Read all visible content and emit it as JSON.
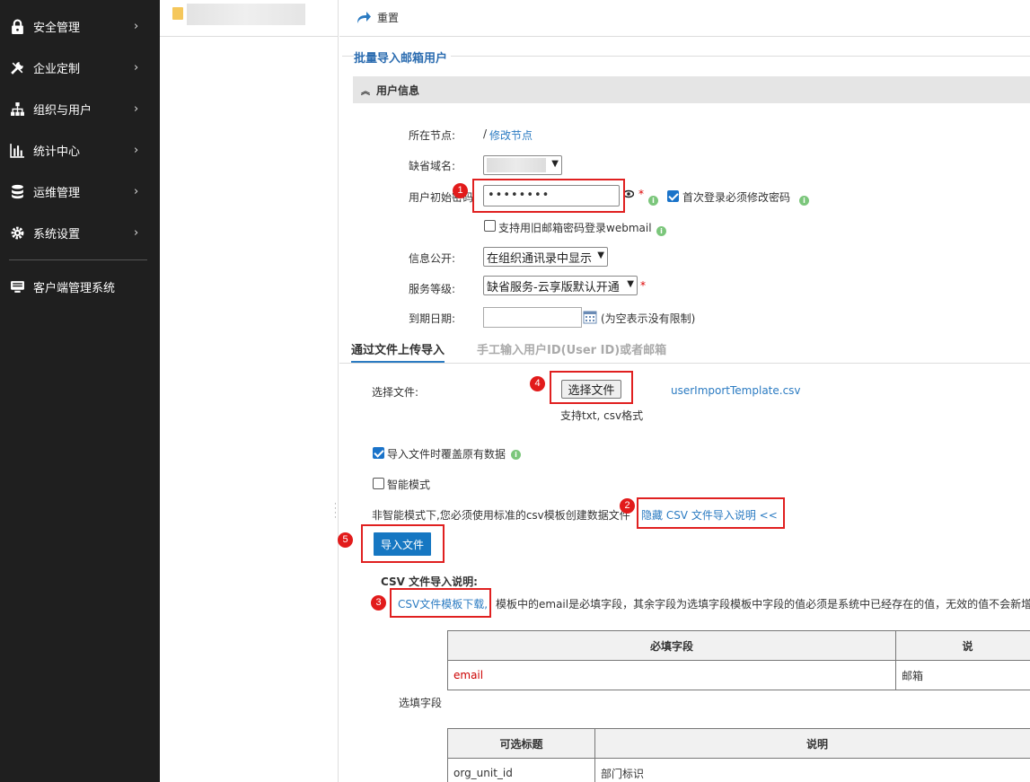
{
  "sidebar": {
    "items": [
      {
        "label": "安全管理",
        "icon": "lock-icon"
      },
      {
        "label": "企业定制",
        "icon": "tools-icon"
      },
      {
        "label": "组织与用户",
        "icon": "org-chart-icon"
      },
      {
        "label": "统计中心",
        "icon": "bar-chart-icon"
      },
      {
        "label": "运维管理",
        "icon": "database-icon"
      },
      {
        "label": "系统设置",
        "icon": "gear-icon"
      }
    ],
    "client_item": {
      "label": "客户端管理系统",
      "icon": "monitor-icon"
    }
  },
  "toolbar": {
    "reset_label": "重置"
  },
  "section": {
    "title": "批量导入邮箱用户"
  },
  "panel": {
    "title": "用户信息"
  },
  "form": {
    "node_label": "所在节点:",
    "node_path": "/",
    "node_link": "修改节点",
    "domain_label": "缺省域名:",
    "password_label": "用户初始密码",
    "password_value": "••••••••",
    "force_change_label": "首次登录必须修改密码",
    "legacy_webmail_label": "支持用旧邮箱密码登录webmail",
    "visibility_label": "信息公开:",
    "visibility_value": "在组织通讯录中显示",
    "service_label": "服务等级:",
    "service_value": "缺省服务-云享版默认开通",
    "expire_label": "到期日期:",
    "expire_hint": "(为空表示没有限制)"
  },
  "tabs": [
    {
      "label": "通过文件上传导入",
      "active": true
    },
    {
      "label": "手工输入用户ID(User ID)或者邮箱",
      "active": false
    }
  ],
  "upload": {
    "file_label": "选择文件:",
    "choose_button": "选择文件",
    "template_link": "userImportTemplate.csv",
    "format_hint": "支持txt, csv格式",
    "overwrite_label": "导入文件时覆盖原有数据",
    "smart_label": "智能模式",
    "notice_text": "非智能模式下,您必须使用标准的csv模板创建数据文件",
    "toggle_link": "隐藏 CSV 文件导入说明 <<",
    "import_button": "导入文件"
  },
  "csv_help": {
    "title": "CSV 文件导入说明:",
    "download_link": "CSV文件模板下载,",
    "description": "模板中的email是必填字段，其余字段为选填字段模板中字段的值必须是系统中已经存在的值，无效的值不会新增到",
    "required_table": {
      "headers": [
        "必填字段",
        "说"
      ],
      "rows": [
        [
          "email",
          "邮箱"
        ]
      ]
    },
    "optional_label": "选填字段",
    "optional_table": {
      "headers": [
        "可选标题",
        "说明"
      ],
      "rows": [
        [
          "org_unit_id",
          "部门标识"
        ]
      ]
    }
  },
  "annotations": [
    "1",
    "2",
    "3",
    "4",
    "5"
  ]
}
